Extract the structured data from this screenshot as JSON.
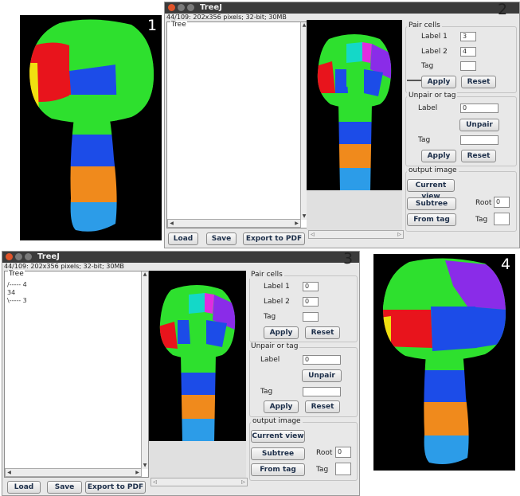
{
  "panel_numbers": [
    "1",
    "2",
    "3",
    "4"
  ],
  "window_title": "TreeJ",
  "status": "44/109: 202x356 pixels; 32-bit; 30MB",
  "tree_panel": {
    "label": "Tree"
  },
  "tree_items_panel3": [
    "/----- 4",
    "34",
    "\\----- 3"
  ],
  "buttons": {
    "load": "Load",
    "save": "Save",
    "export_pdf": "Export to PDF",
    "apply": "Apply",
    "reset": "Reset",
    "unpair": "Unpair",
    "current_view": "Current view",
    "subtree": "Subtree",
    "from_tag": "From tag"
  },
  "pair_cells": {
    "title": "Pair cells",
    "label1": "Label 1",
    "label2": "Label 2",
    "tag": "Tag"
  },
  "unpair_tag": {
    "title": "Unpair or tag",
    "label": "Label",
    "tag": "Tag"
  },
  "output_image": {
    "title": "output image",
    "root": "Root",
    "tag": "Tag"
  },
  "panel2_values": {
    "label1": "3",
    "label2": "4",
    "unpair_label": "0",
    "root": "0"
  },
  "panel3_values": {
    "label1": "0",
    "label2": "0",
    "unpair_label": "0",
    "root": "0"
  },
  "colors": {
    "red": "#e8141c",
    "green": "#2ee02e",
    "yellow": "#f0e010",
    "blue": "#1c4ce8",
    "orange": "#f08a1c",
    "lightblue": "#2c9ce8",
    "purple": "#8a2ce8",
    "magenta": "#e02ce0",
    "cyan": "#14d8c8",
    "titlebar": "#3b3b3b"
  }
}
